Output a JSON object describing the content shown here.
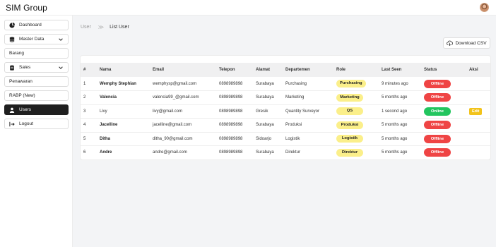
{
  "app": {
    "title": "SIM Group"
  },
  "sidebar": {
    "items": [
      {
        "label": "Dashboard",
        "icon": "pie-chart-icon"
      },
      {
        "label": "Master Data",
        "icon": "database-icon"
      },
      {
        "label": "Barang"
      },
      {
        "label": "Sales",
        "icon": "clipboard-icon"
      },
      {
        "label": "Penawaran"
      },
      {
        "label": "RABP (New)"
      },
      {
        "label": "Users",
        "icon": "user-icon",
        "active": true
      },
      {
        "label": "Logout",
        "icon": "logout-icon"
      }
    ]
  },
  "breadcrumb": {
    "parent": "User",
    "separator": "≫",
    "current": "List User"
  },
  "toolbar": {
    "download_label": "Download CSV"
  },
  "table": {
    "headers": [
      "#",
      "Nama",
      "Email",
      "Telepon",
      "Alamat",
      "Departemen",
      "Role",
      "Last Seen",
      "Status",
      "Aksi"
    ],
    "rows": [
      {
        "no": "1",
        "nama": "Wemphy Stephian",
        "email": "wemphysp@gmail.com",
        "telepon": "0898989898",
        "alamat": "Surabaya",
        "departemen": "Purchasing",
        "role": "Purchasing",
        "last_seen": "9 minutes ago",
        "status": "Offline",
        "aksi": ""
      },
      {
        "no": "2",
        "nama": "Valencia",
        "email": "valencia99_@gmail.com",
        "telepon": "0898989898",
        "alamat": "Surabaya",
        "departemen": "Marketing",
        "role": "Marketing",
        "last_seen": "5 months ago",
        "status": "Offline",
        "aksi": ""
      },
      {
        "no": "3",
        "nama": "Livy",
        "email": "livy@gmail.com",
        "telepon": "0898989898",
        "alamat": "Gresik",
        "departemen": "Quantity Surveyor",
        "role": "QS",
        "last_seen": "1 second ago",
        "status": "Online",
        "aksi": "Edit"
      },
      {
        "no": "4",
        "nama": "Jacelline",
        "email": "jacelline@gmail.com",
        "telepon": "0898989898",
        "alamat": "Surabaya",
        "departemen": "Produksi",
        "role": "Produksi",
        "last_seen": "5 months ago",
        "status": "Offline",
        "aksi": ""
      },
      {
        "no": "5",
        "nama": "Ditha",
        "email": "ditha_90@gmail.com",
        "telepon": "0898989898",
        "alamat": "Sidoarjo",
        "departemen": "Logistik",
        "role": "Logistik",
        "last_seen": "5 months ago",
        "status": "Offline",
        "aksi": ""
      },
      {
        "no": "6",
        "nama": "Andre",
        "email": "andre@gmail.com",
        "telepon": "0898989898",
        "alamat": "Surabaya",
        "departemen": "Direktur",
        "role": "Direktur",
        "last_seen": "5 months ago",
        "status": "Offline",
        "aksi": ""
      }
    ]
  },
  "colors": {
    "offline": "#ef4444",
    "online": "#22c55e",
    "role_pill": "#fbef8a",
    "edit": "#f2c31b",
    "active_nav": "#1f1f1f"
  }
}
